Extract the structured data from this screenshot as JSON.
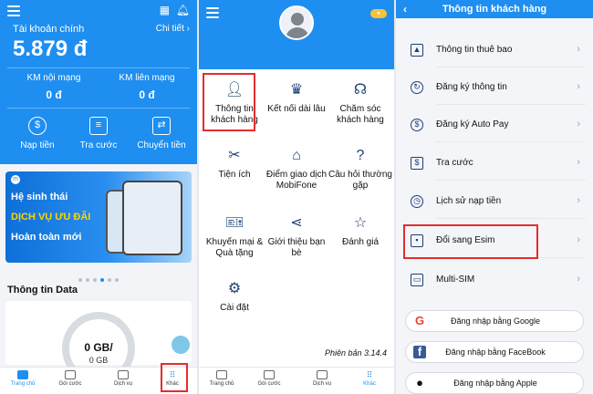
{
  "panel1": {
    "account_label": "Tài khoản chính",
    "detail_link": "Chi tiết ›",
    "balance": "5.879 đ",
    "km_noi_mang_label": "KM nội mạng",
    "km_noi_mang_value": "0 đ",
    "km_lien_mang_label": "KM liên mạng",
    "km_lien_mang_value": "0 đ",
    "actions": [
      "Nạp tiền",
      "Tra cước",
      "Chuyển tiền"
    ],
    "banner": {
      "line1": "Hệ sinh thái",
      "line2": "DỊCH VỤ ƯU ĐÃI",
      "line3": "Hoàn toàn mới"
    },
    "data_title": "Thông tin Data",
    "data_value": "0 GB/",
    "data_total": "0 GB",
    "nav": [
      "Trang chủ",
      "Gói cước",
      "Dịch vụ",
      "Khác"
    ]
  },
  "panel2": {
    "menu": [
      "Thông tin khách hàng",
      "Kết nối dài lâu",
      "Chăm sóc khách hàng",
      "Tiện ích",
      "Điểm giao dịch MobiFone",
      "Câu hỏi thường gặp",
      "Khuyến mại & Quà tặng",
      "Giới thiệu bạn bè",
      "Đánh giá",
      "Cài đặt"
    ],
    "version": "Phiên bản 3.14.4",
    "nav": [
      "Trang chủ",
      "Gói cước",
      "Dịch vụ",
      "Khác"
    ]
  },
  "panel3": {
    "title": "Thông tin khách hàng",
    "rows": [
      "Thông tin thuê bao",
      "Đăng ký thông tin",
      "Đăng ký Auto Pay",
      "Tra cước",
      "Lịch sử nạp tiền",
      "Đổi sang Esim",
      "Multi-SIM"
    ],
    "logins": [
      "Đăng nhập bằng Google",
      "Đăng nhập bằng FaceBook",
      "Đăng nhập bằng Apple"
    ]
  }
}
